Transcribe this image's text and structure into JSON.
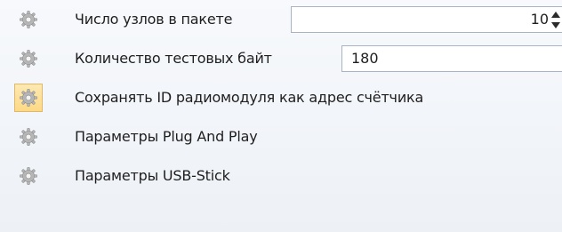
{
  "settings": {
    "rows": [
      {
        "label": "Число узлов в пакете",
        "icon": "gear-icon",
        "value": "10"
      },
      {
        "label": "Количество тестовых байт",
        "icon": "gear-icon",
        "value": "180"
      },
      {
        "label": "Сохранять ID радиомодуля как адрес счётчика",
        "icon": "gear-icon"
      },
      {
        "label": "Параметры Plug And Play",
        "icon": "gear-icon"
      },
      {
        "label": "Параметры USB-Stick",
        "icon": "gear-icon"
      }
    ]
  },
  "colors": {
    "highlight_bg": "#fcd985",
    "highlight_border": "#e2b765",
    "input_border": "#a8b4c4"
  }
}
